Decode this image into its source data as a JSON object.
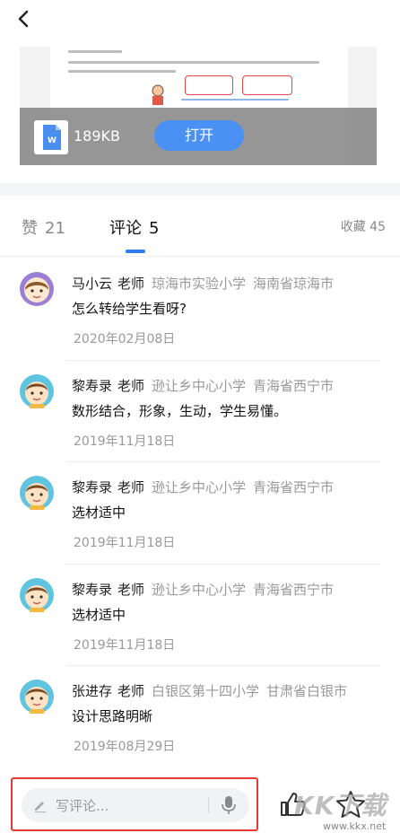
{
  "file": {
    "size": "189KB",
    "open_label": "打开"
  },
  "tabs": {
    "likes_label": "赞",
    "likes_count": "21",
    "comments_label": "评论",
    "comments_count": "5",
    "favorites": "收藏 45"
  },
  "comments": [
    {
      "name": "马小云",
      "role": "老师",
      "school": "琼海市实验小学",
      "location": "海南省琼海市",
      "text": "怎么转给学生看呀?",
      "date": "2020年02月08日",
      "avatar": "female-teacher-avatar"
    },
    {
      "name": "黎寿录",
      "role": "老师",
      "school": "逊让乡中心小学",
      "location": "青海省西宁市",
      "text": "数形结合，形象，生动，学生易懂。",
      "date": "2019年11月18日",
      "avatar": "male-teacher-avatar"
    },
    {
      "name": "黎寿录",
      "role": "老师",
      "school": "逊让乡中心小学",
      "location": "青海省西宁市",
      "text": "选材适中",
      "date": "2019年11月18日",
      "avatar": "male-teacher-avatar"
    },
    {
      "name": "黎寿录",
      "role": "老师",
      "school": "逊让乡中心小学",
      "location": "青海省西宁市",
      "text": "选材适中",
      "date": "2019年11月18日",
      "avatar": "male-teacher-avatar"
    },
    {
      "name": "张进存",
      "role": "老师",
      "school": "白银区第十四小学",
      "location": "甘肃省白银市",
      "text": "设计思路明晰",
      "date": "2019年08月29日",
      "avatar": "male-teacher-avatar"
    }
  ],
  "bottom": {
    "input_placeholder": "写评论..."
  },
  "watermark": {
    "logo": "KK下载",
    "url": "www.kkx.net"
  },
  "colors": {
    "accent": "#2f7cf6",
    "open_button": "#4a90f5",
    "highlight_border": "#e53935",
    "muted_text": "#999999"
  },
  "icons": [
    "back-arrow-icon",
    "word-file-icon",
    "pencil-icon",
    "microphone-icon",
    "thumbs-up-icon",
    "star-icon"
  ]
}
